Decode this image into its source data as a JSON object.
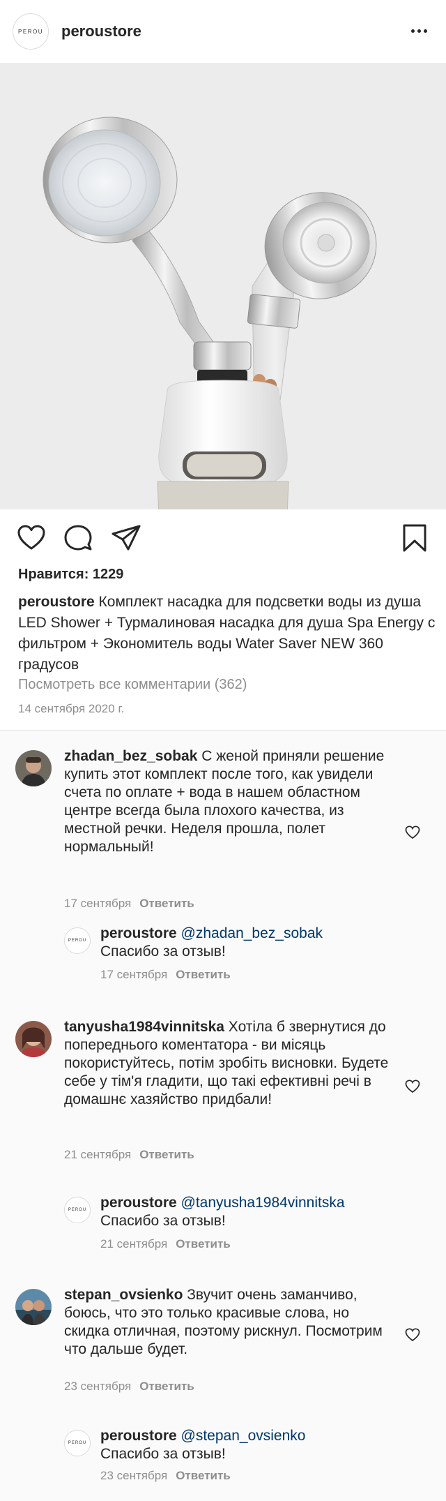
{
  "header": {
    "logo_text": "PEROU",
    "username": "peroustore"
  },
  "actions": {
    "icons": [
      "heart-icon",
      "comment-icon",
      "share-icon",
      "bookmark-icon"
    ]
  },
  "post": {
    "likes_label": "Нравится: 1229",
    "caption_user": "peroustore",
    "caption_text": "Комплект насадка для подсветки воды из душа LED Shower + Турмалиновая насадка для душа Spa Energy с фильтром + Экономитель воды Water Saver NEW 360 градусов",
    "view_all": "Посмотреть все комментарии (362)",
    "date": "14 сентября 2020 г."
  },
  "comments": [
    {
      "user": "zhadan_bez_sobak",
      "text": "С женой приняли решение купить этот комплект после того, как увидели счета по оплате + вода в нашем областном центре всегда была плохого качества, из местной речки. Неделя прошла, полет нормальный!",
      "date": "17 сентября",
      "reply_label": "Ответить",
      "reply": {
        "user": "peroustore",
        "mention": "@zhadan_bez_sobak",
        "text": "Спасибо за отзыв!",
        "date": "17 сентября",
        "reply_label": "Ответить"
      }
    },
    {
      "user": "tanyusha1984vinnitska",
      "text": "Хотіла б звернутися до попереднього коментатора - ви місяць покористуйтесь, потім зробіть висновки. Будете себе у тім'я гладити, що такі ефективні речі в домашнє хазяйство придбали!",
      "date": "21 сентября",
      "reply_label": "Ответить",
      "reply": {
        "user": "peroustore",
        "mention": "@tanyusha1984vinnitska",
        "text": "Спасибо за отзыв!",
        "date": "21 сентября",
        "reply_label": "Ответить"
      }
    },
    {
      "user": "stepan_ovsienko",
      "text": "Звучит очень заманчиво, боюсь, что это только красивые слова, но скидка отличная, поэтому рискнул. Посмотрим что дальше будет.",
      "date": "23 сентября",
      "reply_label": "Ответить",
      "reply": {
        "user": "peroustore",
        "mention": "@stepan_ovsienko",
        "text": "Спасибо за отзыв!",
        "date": "23 сентября",
        "reply_label": "Ответить"
      }
    }
  ],
  "colors": {
    "text": "#262626",
    "secondary": "#8e8e8e",
    "mention": "#00376b",
    "photo_bg": "#ececec"
  }
}
